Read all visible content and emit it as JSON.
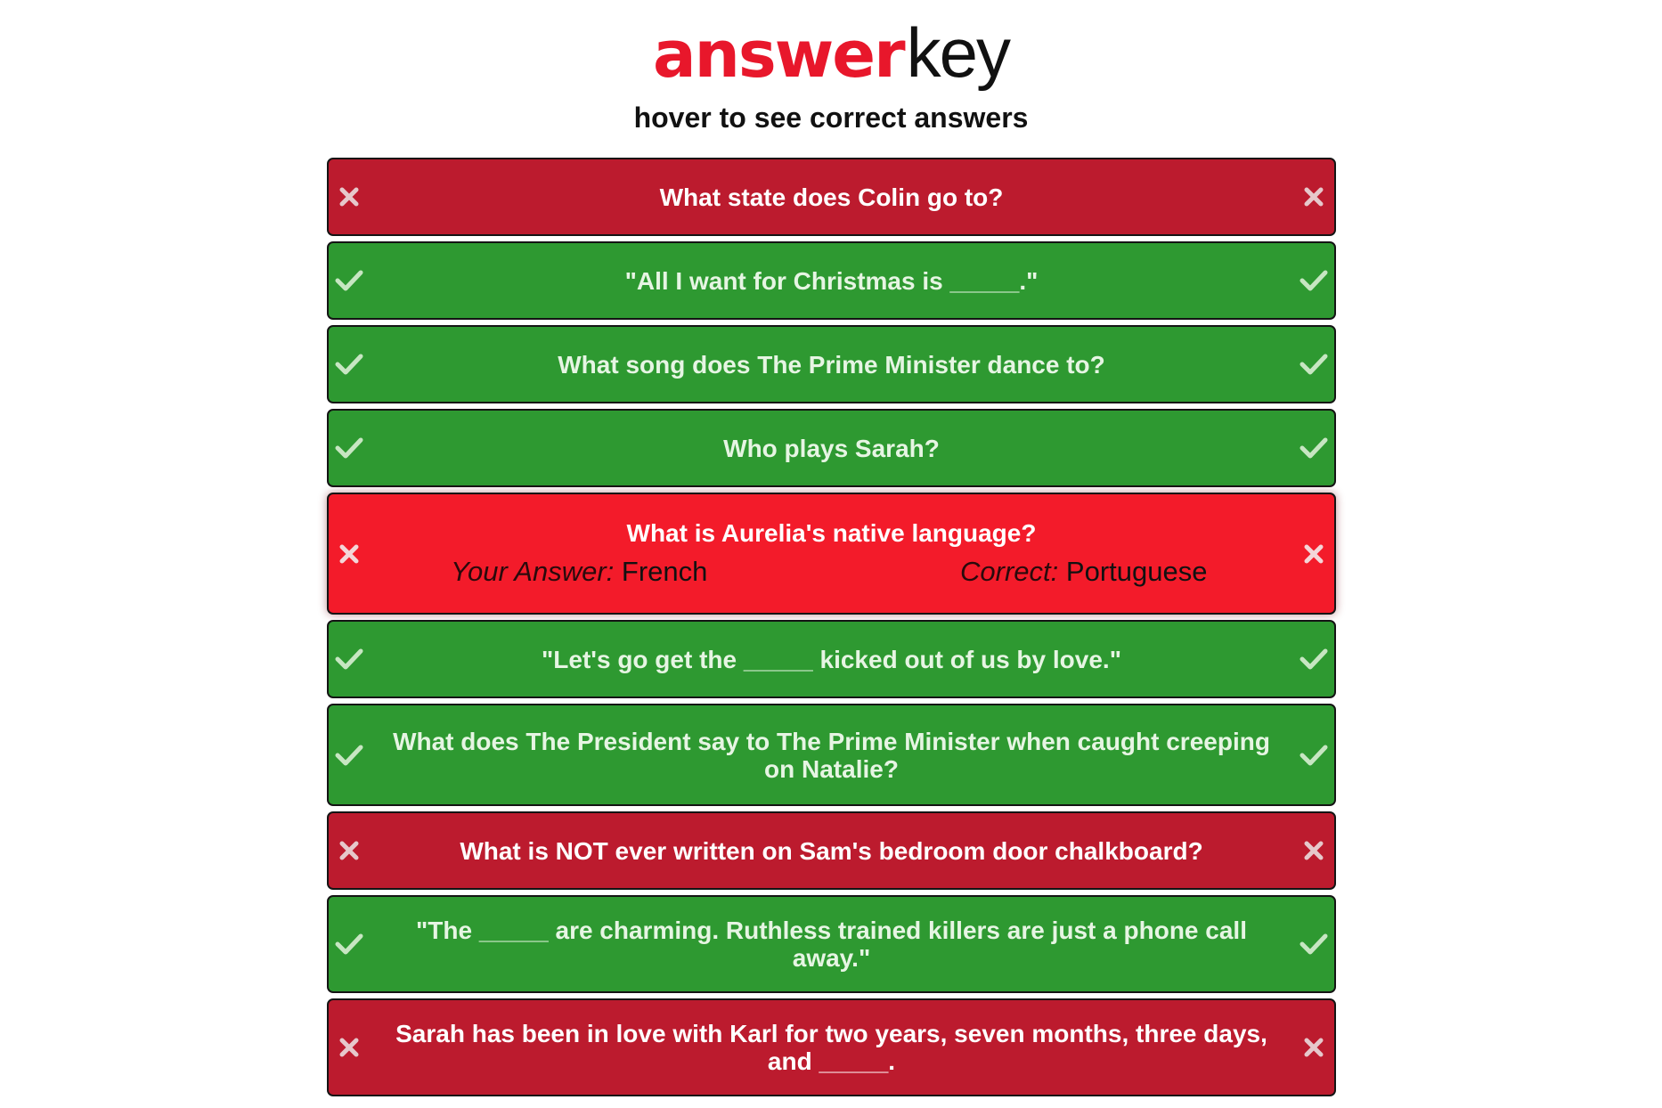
{
  "header": {
    "logo_answer": "answer",
    "logo_key": "key",
    "subtitle": "hover to see correct answers"
  },
  "colors": {
    "correct": "#2e9931",
    "wrong": "#bc1b2e",
    "wrong_active": "#f31b2a",
    "brand_red": "#e8172b"
  },
  "questions": [
    {
      "text": "What state does Colin go to?",
      "status": "wrong",
      "icon": "x-icon"
    },
    {
      "text": "\"All I want for Christmas is _____.\"",
      "status": "correct",
      "icon": "check-icon"
    },
    {
      "text": "What song does The Prime Minister dance to?",
      "status": "correct",
      "icon": "check-icon"
    },
    {
      "text": "Who plays Sarah?",
      "status": "correct",
      "icon": "check-icon"
    },
    {
      "text": "What is Aurelia's native language?",
      "status": "wrong",
      "icon": "x-icon",
      "your_answer_label": "Your Answer:",
      "your_answer": "French",
      "correct_label": "Correct:",
      "correct_answer": "Portuguese"
    },
    {
      "text": "\"Let's go get the _____ kicked out of us by love.\"",
      "status": "correct",
      "icon": "check-icon"
    },
    {
      "text": "What does The President say to The Prime Minister when caught creeping on Natalie?",
      "status": "correct",
      "icon": "check-icon"
    },
    {
      "text": "What is NOT ever written on Sam's bedroom door chalkboard?",
      "status": "wrong",
      "icon": "x-icon"
    },
    {
      "text": "\"The _____ are charming. Ruthless trained killers are just a phone call away.\"",
      "status": "correct",
      "icon": "check-icon"
    },
    {
      "text": "Sarah has been in love with Karl for two years, seven months, three days, and _____.",
      "status": "wrong",
      "icon": "x-icon"
    }
  ]
}
